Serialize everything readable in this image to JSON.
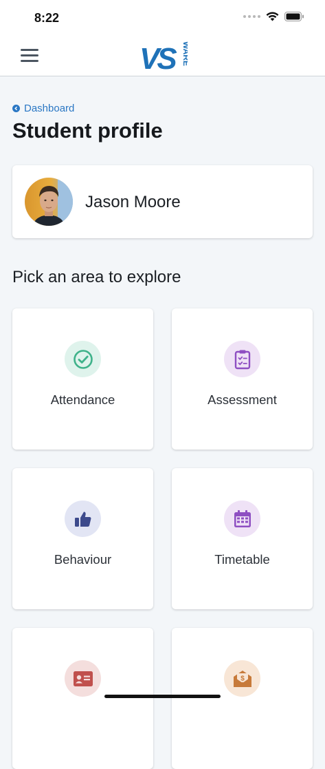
{
  "status_bar": {
    "time": "8:22"
  },
  "header": {
    "logo_text": "VS",
    "logo_subtext": "WARE"
  },
  "breadcrumb": {
    "label": "Dashboard"
  },
  "page": {
    "title": "Student profile"
  },
  "student": {
    "name": "Jason Moore"
  },
  "section": {
    "heading": "Pick an area to explore"
  },
  "areas": [
    {
      "label": "Attendance",
      "icon": "check-circle-icon",
      "color": "#3fb28a",
      "bg": "#dff3ec"
    },
    {
      "label": "Assessment",
      "icon": "clipboard-icon",
      "color": "#8e4fc2",
      "bg": "#efe2f6"
    },
    {
      "label": "Behaviour",
      "icon": "thumbs-up-icon",
      "color": "#3d4a8c",
      "bg": "#e2e5f4"
    },
    {
      "label": "Timetable",
      "icon": "calendar-icon",
      "color": "#8e4fc2",
      "bg": "#efe2f6"
    },
    {
      "label": "",
      "icon": "id-card-icon",
      "color": "#c0504d",
      "bg": "#f4dedd"
    },
    {
      "label": "",
      "icon": "money-envelope-icon",
      "color": "#c77a3a",
      "bg": "#f8e6d6"
    }
  ],
  "colors": {
    "accent": "#2a77c4",
    "logo": "#1f72b8"
  }
}
